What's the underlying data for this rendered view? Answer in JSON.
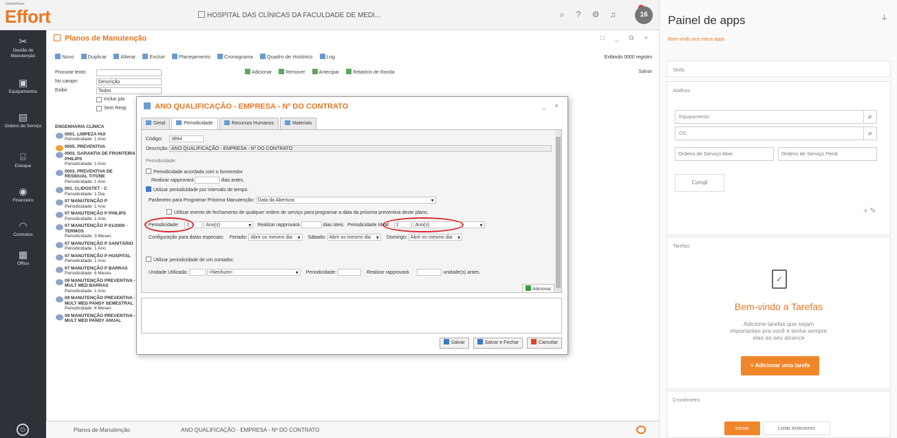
{
  "brand": {
    "small": "GlobalFlows",
    "name": "Effort"
  },
  "header": {
    "hospital": "HOSPITAL DAS CLÍNICAS DA FACULDADE DE MEDI...",
    "avatar": "16",
    "accent": "#e87722"
  },
  "sidebar": {
    "items": [
      {
        "label": "Gestão de Manutenção",
        "icon": "wrench-icon"
      },
      {
        "label": "Equipamentos",
        "icon": "monitor-icon"
      },
      {
        "label": "Ordens de Serviço",
        "icon": "document-icon"
      },
      {
        "label": "Estoque",
        "icon": "box-icon"
      },
      {
        "label": "Financeiro",
        "icon": "coin-icon"
      },
      {
        "label": "Contratos",
        "icon": "gauge-icon"
      },
      {
        "label": "Office",
        "icon": "file-icon"
      }
    ]
  },
  "page": {
    "title": "Planos de Manutenção",
    "toolbar": [
      "Novo",
      "Duplicar",
      "Alterar",
      "Excluir",
      "Planejamento",
      "Cronograma",
      "Quadro de Histórico",
      "Log"
    ],
    "records": "Exibindo 0000 registro",
    "filters": {
      "search_label": "Procurar texto:",
      "field_label": "No campo:",
      "field_value": "Descrição",
      "filter_label": "Exibir:",
      "filter_value": "Todos",
      "check1": "Incluir pla",
      "check2": "Sem Resp"
    },
    "tree": {
      "root": "ENGENHARIA CLÍNICA",
      "nodes": [
        {
          "title": "0001. LIMPEZA HUI",
          "sub": "Periodicidade: 1 Ano"
        },
        {
          "title": "0005. PREVENTIVA",
          "sub": ""
        },
        {
          "title": "0003. GARANTIA DE FRONTEIRA PHILIPS",
          "sub": "Periodicidade: 1 Ano"
        },
        {
          "title": "0003. PREVENTIVA DE RESIDUAL TITONE",
          "sub": "Periodicidade: 1 Ano"
        },
        {
          "title": "001. CLIDOSTET - C",
          "sub": "Periodicidade: 1 Dia"
        },
        {
          "title": "07 MANUTENÇÃO P",
          "sub": "Periodicidade: 1 Ano"
        },
        {
          "title": "07 MANUTENÇÃO P PHILIPS",
          "sub": "Periodicidade: 1 Ano"
        },
        {
          "title": "07 MANUTENÇÃO P 01/2000 - TERMOS",
          "sub": "Periodicidade: 3 Meses"
        },
        {
          "title": "07 MANUTENÇÃO P SANITÁRIO",
          "sub": "Periodicidade: 1 Ano"
        },
        {
          "title": "07 MANUTENÇÃO P HOSPITAL",
          "sub": "Periodicidade: 1 Ano"
        },
        {
          "title": "07 MANUTENÇÃO P BARRAS",
          "sub": "Periodicidade: 6 Meses"
        },
        {
          "title": "09 MANUTENÇÃO PREVENTIVA - MULT MED BARRAS",
          "sub": "Periodicidade: 1 Ano"
        },
        {
          "title": "09 MANUTENÇÃO PREVENTIVA - MULT MED PANDY SEMESTRAL",
          "sub": "Periodicidade: 6 Meses"
        },
        {
          "title": "09 MANUTENÇÃO PREVENTIVA - MULT MED PANDY ANUAL",
          "sub": ""
        }
      ]
    },
    "right_toolbar": [
      "Adicionar",
      "Remover",
      "Antecipar",
      "Relatório de Ronda"
    ],
    "save": "Salvar"
  },
  "dialog": {
    "title": "ANO QUALIFICAÇÃO - EMPRESA - Nº DO CONTRATO",
    "tabs": [
      "Geral",
      "Periodicidade",
      "Recursos Humanos",
      "Materiais"
    ],
    "codigo_label": "Código:",
    "codigo_value": "3894",
    "descricao_label": "Descrição:",
    "descricao_value": "ANO QUALIFICAÇÃO - EMPRESA - Nº DO CONTRATO",
    "period_header": "Periodicidade:",
    "opt1": "Periodicidade acordada com o fornecedor",
    "realizar": "Realizar rapprovará",
    "dias_antes": "dias antes.",
    "opt2": "Utilizar periodicidade por intervalo de tempo.",
    "param_label": "Parâmetro para Programar Próxima Manutenção:",
    "param_value": "Data da Abertura",
    "opt3": "Utilizar evento de fechamento de qualquer ordem de serviço para programar a data da próxima preventiva deste plano.",
    "periodicidade_label": "Periodicidade:",
    "periodicidade_value": "1",
    "periodicidade_unit": "Ano(s)",
    "realizar2": "Realizar rapprovará",
    "dias_uteis": "dias úteis",
    "period_ideal_label": "Periodicidade Ideal:",
    "period_ideal_value": "1",
    "period_ideal_unit": "Ano(s)",
    "config_label": "Configuração para datas especiais:",
    "feriado_label": "Feriado:",
    "feriado_value": "Abrir os mesmo dia",
    "sabado_label": "Sábado:",
    "sabado_value": "Abrir os mesmo dia",
    "domingo_label": "Domingo:",
    "domingo_value": "Abrir os mesmo dia",
    "opt4": "Utilizar periodicidade de um contador.",
    "unidade_label": "Unidade Utilizada:",
    "unidade_value": "<Nenhum>",
    "period2_label": "Periodicidade:",
    "realizar3": "Realizar rapprovará",
    "unidades_antes": "unidade(s) antes.",
    "add": "Adicionar",
    "buttons": [
      "Salvar",
      "Salvar e Fechar",
      "Cancelar"
    ]
  },
  "bottombar": {
    "tab1": "Planos de Manutenção",
    "tab2": "ANO QUALIFICAÇÃO - EMPRESA - Nº DO CONTRATO"
  },
  "panel": {
    "title": "Painel de apps",
    "welcome": "Bem vindo aos meus apps",
    "sections": [
      "Skills",
      "Atalhos",
      "Tarefas",
      "Cronômetro"
    ],
    "inputs": [
      "Equipamento",
      "OS"
    ],
    "selects": [
      "Ordens de Serviço Aber",
      "Ordens de Serviço Pend"
    ],
    "compl": "Compl",
    "tarefas_title": "Bem-vindo a Tarefas",
    "tarefas_text": "Adicione tarefas que sejam importantes pra você e tenha sempre elas ao seu alcance",
    "add_task": "+ Adicionar uma tarefa",
    "iniciar": "Iniciar",
    "listar": "Listar Anteriores"
  }
}
